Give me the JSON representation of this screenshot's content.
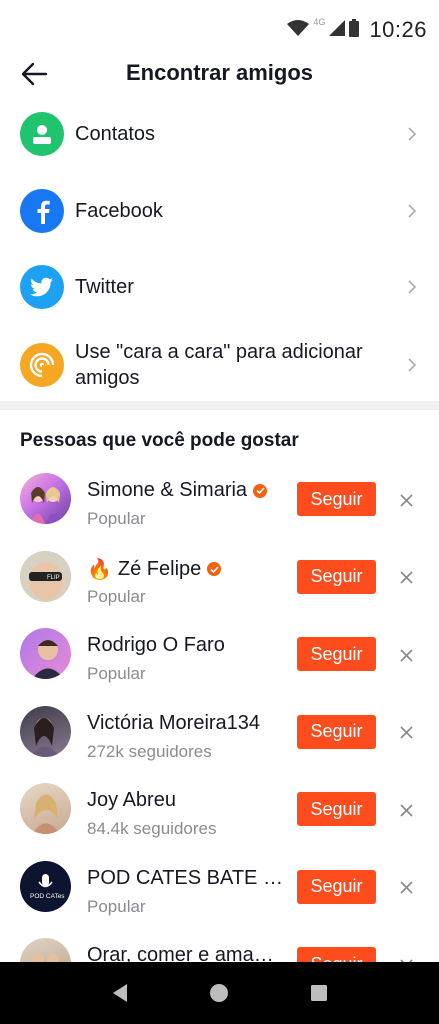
{
  "status_bar": {
    "time": "10:26",
    "network": "4G"
  },
  "header": {
    "title": "Encontrar amigos"
  },
  "options": [
    {
      "label": "Contatos",
      "icon": "contacts-icon",
      "color": "#20c46f"
    },
    {
      "label": "Facebook",
      "icon": "facebook-icon",
      "color": "#1877f2"
    },
    {
      "label": "Twitter",
      "icon": "twitter-icon",
      "color": "#1da1f2"
    },
    {
      "label": "Use \"cara a cara\" para adicionar amigos",
      "icon": "face-to-face-icon",
      "color": "#f5a623"
    }
  ],
  "suggestions": {
    "title": "Pessoas que você pode gostar",
    "follow_label": "Seguir",
    "people": [
      {
        "name": "Simone & Simaria",
        "sub": "Popular",
        "verified": true,
        "prefix": ""
      },
      {
        "name": "Zé Felipe",
        "sub": "Popular",
        "verified": true,
        "prefix": "🔥"
      },
      {
        "name": "Rodrigo O Faro",
        "sub": "Popular",
        "verified": false,
        "prefix": ""
      },
      {
        "name": "Victória Moreira134",
        "sub": "272k seguidores",
        "verified": false,
        "prefix": ""
      },
      {
        "name": "Joy Abreu",
        "sub": "84.4k seguidores",
        "verified": false,
        "prefix": ""
      },
      {
        "name": "POD CATES BATE …",
        "sub": "Popular",
        "verified": false,
        "prefix": ""
      },
      {
        "name": "Orar, comer e ama…",
        "sub": "",
        "verified": false,
        "prefix": ""
      }
    ]
  },
  "colors": {
    "accent": "#fe4c1c",
    "verified": "#f2620f",
    "secondary_text": "#8a8b91"
  }
}
